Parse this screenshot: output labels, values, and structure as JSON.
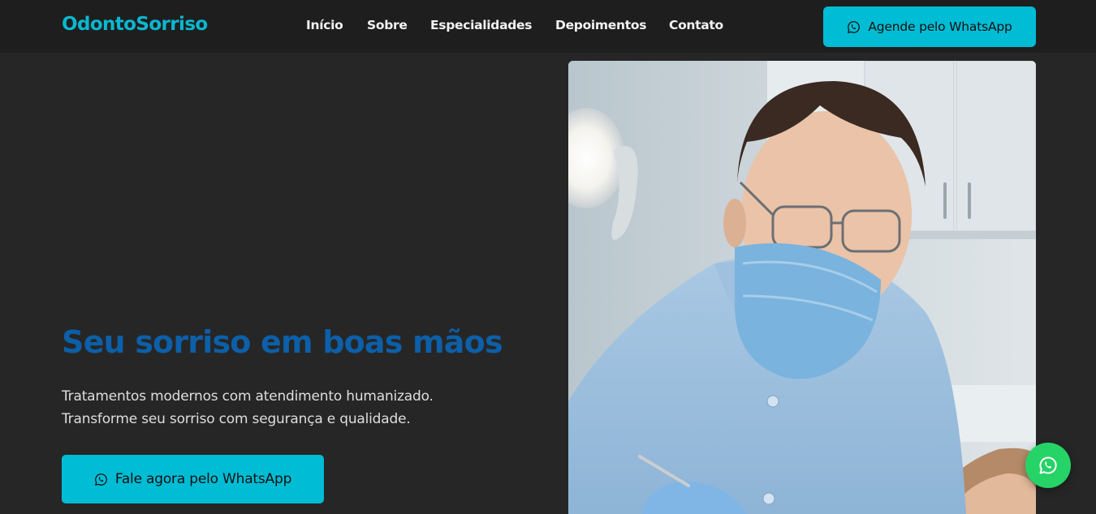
{
  "brand": {
    "logo_text": "OdontoSorriso"
  },
  "nav": {
    "items": [
      {
        "label": "Início"
      },
      {
        "label": "Sobre"
      },
      {
        "label": "Especialidades"
      },
      {
        "label": "Depoimentos"
      },
      {
        "label": "Contato"
      }
    ]
  },
  "header": {
    "cta_label": "Agende pelo WhatsApp",
    "cta_icon": "whatsapp-icon"
  },
  "hero": {
    "title": "Seu sorriso em boas mãos",
    "subtitle_line1": "Tratamentos modernos com atendimento humanizado.",
    "subtitle_line2": "Transforme seu sorriso com segurança e qualidade.",
    "cta_label": "Fale agora pelo WhatsApp",
    "cta_icon": "whatsapp-icon",
    "image": "dentist-photo"
  },
  "floating": {
    "icon": "whatsapp-icon"
  },
  "colors": {
    "accent": "#00bcd4",
    "logo": "#0ab7d0",
    "title": "#0c5fa8",
    "background": "#262626",
    "header_bg": "#1e1e1e",
    "whatsapp_green": "#25d366"
  }
}
